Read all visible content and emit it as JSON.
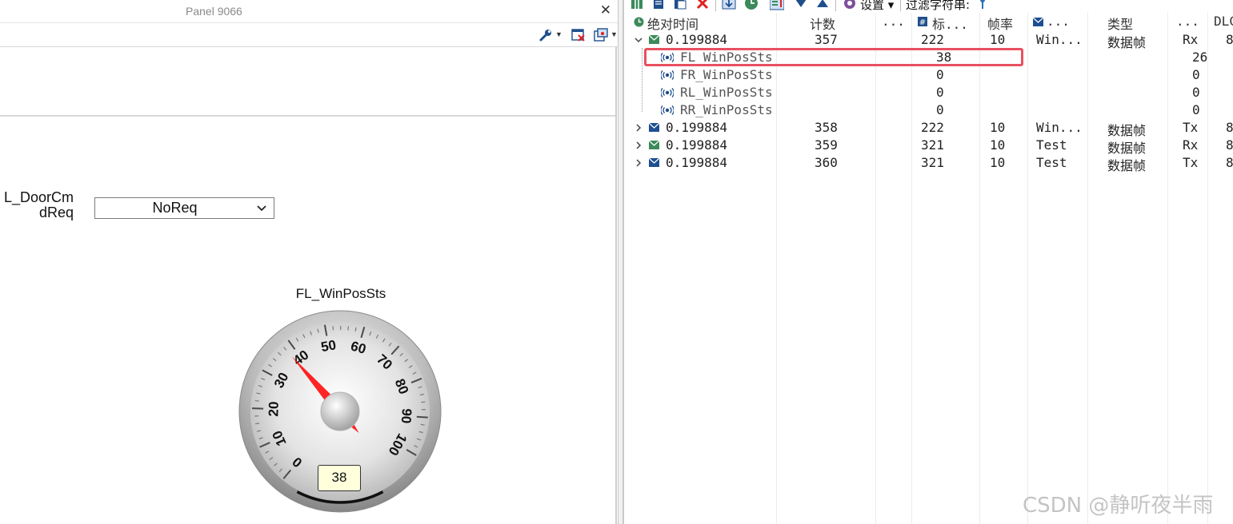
{
  "panel": {
    "title": "Panel 9066",
    "close_icon": "close-icon"
  },
  "left_toolbar": {
    "icons": [
      "wrench-icon",
      "chevron-down-icon",
      "remove-window-icon",
      "window-settings-icon",
      "chevron-down-icon"
    ]
  },
  "door_control": {
    "label_line1": "L_DoorCm",
    "label_line2": "dReq",
    "selected": "NoReq"
  },
  "gauge": {
    "title": "FL_WinPosSts",
    "value": 38,
    "value_text": "38",
    "min": 0,
    "max": 100,
    "ticks": [
      "0",
      "10",
      "20",
      "30",
      "40",
      "50",
      "60",
      "70",
      "80",
      "90",
      "100"
    ],
    "needle_color": "#ff0000"
  },
  "right_toolbar": {
    "settings_label": "设置",
    "filter_label": "过滤字符串:"
  },
  "table": {
    "headers": {
      "time": "绝对时间",
      "count": "计数",
      "dots1": "...",
      "ident": "标...",
      "rate": "帧率",
      "name": "...",
      "type": "类型",
      "dir": "...",
      "dlc": "DLC"
    },
    "rows": [
      {
        "time": "0.199884",
        "count": "357",
        "ident": "222",
        "rate": "10",
        "name": "Win...",
        "type": "数据帧",
        "dir": "Rx",
        "dlc": "8",
        "expanded": true,
        "icon_color": "#3c8a5a"
      },
      {
        "time": "0.199884",
        "count": "358",
        "ident": "222",
        "rate": "10",
        "name": "Win...",
        "type": "数据帧",
        "dir": "Tx",
        "dlc": "8",
        "expanded": false,
        "icon_color": "#1d4f91"
      },
      {
        "time": "0.199884",
        "count": "359",
        "ident": "321",
        "rate": "10",
        "name": "Test",
        "type": "数据帧",
        "dir": "Rx",
        "dlc": "8",
        "expanded": false,
        "icon_color": "#3c8a5a"
      },
      {
        "time": "0.199884",
        "count": "360",
        "ident": "321",
        "rate": "10",
        "name": "Test",
        "type": "数据帧",
        "dir": "Tx",
        "dlc": "8",
        "expanded": false,
        "icon_color": "#1d4f91"
      }
    ],
    "signals": [
      {
        "name": "FL_WinPosSts",
        "value": "38",
        "raw": "26"
      },
      {
        "name": "FR_WinPosSts",
        "value": "0",
        "raw": "0"
      },
      {
        "name": "RL_WinPosSts",
        "value": "0",
        "raw": "0"
      },
      {
        "name": "RR_WinPosSts",
        "value": "0",
        "raw": "0"
      }
    ],
    "highlight_color": "#e8505f"
  },
  "watermark": "CSDN @静听夜半雨"
}
